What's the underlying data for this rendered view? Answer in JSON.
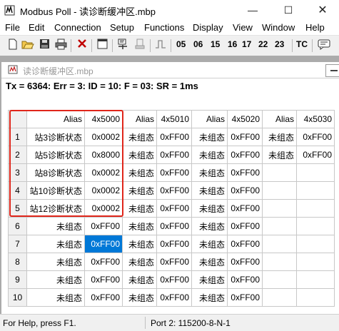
{
  "window": {
    "title": "Modbus Poll - 读诊断缓冲区.mbp",
    "minimize_glyph": "—",
    "maximize_glyph": "☐",
    "close_glyph": "✕"
  },
  "menu": [
    "File",
    "Edit",
    "Connection",
    "Setup",
    "Functions",
    "Display",
    "View",
    "Window",
    "Help"
  ],
  "toolbar": {
    "icons": [
      "new-file-icon",
      "open-folder-icon",
      "save-icon",
      "print-icon",
      "delete-icon",
      "window-icon",
      "read-write-icon",
      "read-icon",
      "pulse-icon"
    ],
    "function_codes": [
      "05",
      "06",
      "15",
      "16",
      "17",
      "22",
      "23"
    ],
    "tc_label": "TC",
    "extra_icon": "comment-icon"
  },
  "child_window": {
    "title": "读诊断缓冲区.mbp",
    "status": "Tx = 6364: Err = 3: ID = 10: F = 03: SR = 1ms"
  },
  "grid": {
    "headers": [
      "Alias",
      "4x5000",
      "Alias",
      "4x5010",
      "Alias",
      "4x5020",
      "Alias",
      "4x5030"
    ],
    "rows": [
      {
        "num": "1",
        "cells": [
          "站3诊断状态",
          "0x0002",
          "未组态",
          "0xFF00",
          "未组态",
          "0xFF00",
          "未组态",
          "0xFF00"
        ]
      },
      {
        "num": "2",
        "cells": [
          "站5诊断状态",
          "0x8000",
          "未组态",
          "0xFF00",
          "未组态",
          "0xFF00",
          "未组态",
          "0xFF00"
        ]
      },
      {
        "num": "3",
        "cells": [
          "站8诊断状态",
          "0x0002",
          "未组态",
          "0xFF00",
          "未组态",
          "0xFF00",
          "",
          ""
        ]
      },
      {
        "num": "4",
        "cells": [
          "站10诊断状态",
          "0x0002",
          "未组态",
          "0xFF00",
          "未组态",
          "0xFF00",
          "",
          ""
        ]
      },
      {
        "num": "5",
        "cells": [
          "站12诊断状态",
          "0x0002",
          "未组态",
          "0xFF00",
          "未组态",
          "0xFF00",
          "",
          ""
        ]
      },
      {
        "num": "6",
        "cells": [
          "未组态",
          "0xFF00",
          "未组态",
          "0xFF00",
          "未组态",
          "0xFF00",
          "",
          ""
        ]
      },
      {
        "num": "7",
        "cells": [
          "未组态",
          "0xFF00",
          "未组态",
          "0xFF00",
          "未组态",
          "0xFF00",
          "",
          ""
        ]
      },
      {
        "num": "8",
        "cells": [
          "未组态",
          "0xFF00",
          "未组态",
          "0xFF00",
          "未组态",
          "0xFF00",
          "",
          ""
        ]
      },
      {
        "num": "9",
        "cells": [
          "未组态",
          "0xFF00",
          "未组态",
          "0xFF00",
          "未组态",
          "0xFF00",
          "",
          ""
        ]
      },
      {
        "num": "10",
        "cells": [
          "未组态",
          "0xFF00",
          "未组态",
          "0xFF00",
          "未组态",
          "0xFF00",
          "",
          ""
        ]
      }
    ],
    "selected": {
      "row": 7,
      "column": "4x5000"
    }
  },
  "statusbar": {
    "help": "For Help, press F1.",
    "port": "Port 2: 115200-8-N-1"
  },
  "colors": {
    "selection": "#0078d7",
    "highlight_box": "#e0261b",
    "mdi_background": "#ababab"
  }
}
